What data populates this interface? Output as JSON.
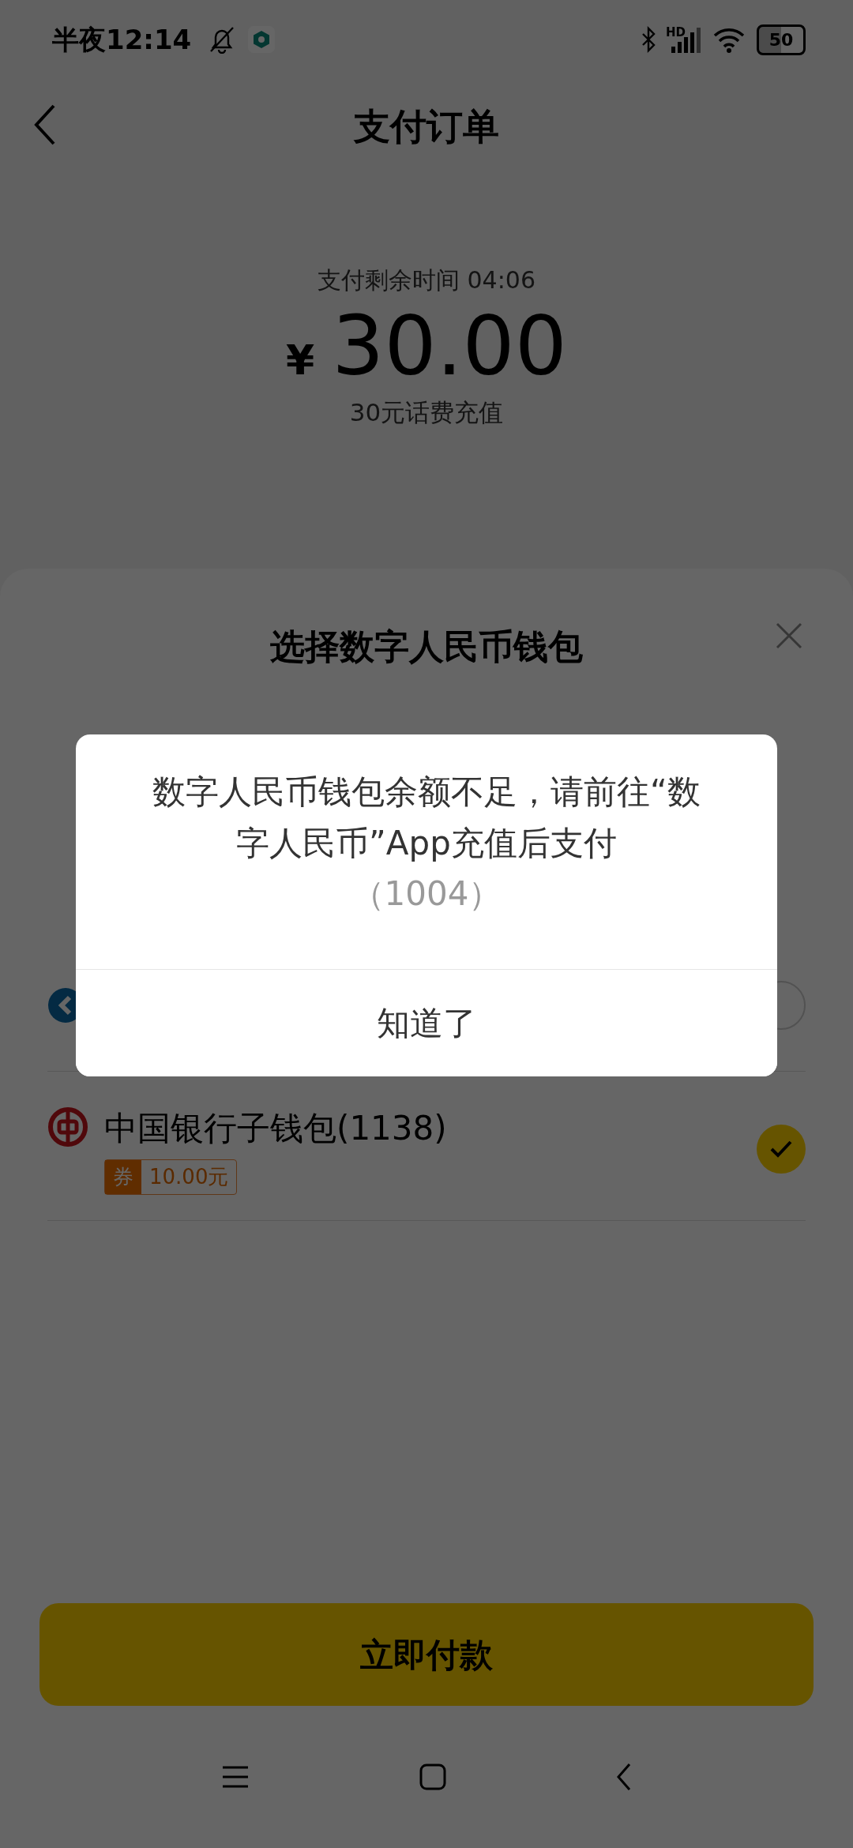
{
  "status_bar": {
    "time": "半夜12:14",
    "network": "HD",
    "battery": "50"
  },
  "header": {
    "title": "支付订单"
  },
  "order": {
    "timer_label": "支付剩余时间",
    "timer": "04:06",
    "currency": "¥",
    "amount": "30.00",
    "description": "30元话费充值"
  },
  "sheet": {
    "title": "选择数字人民币钱包",
    "wallets": [
      {
        "kind": "hidden",
        "selected": false
      },
      {
        "kind": "bank",
        "name": "中国银行子钱包(1138)",
        "coupon_label": "券",
        "coupon_amount": "10.00元",
        "selected": true
      }
    ],
    "pay_button": "立即付款"
  },
  "dialog": {
    "message": "数字人民币钱包余额不足，请前往“数字人民币”App充值后支付",
    "code": "（1004）",
    "button": "知道了"
  }
}
